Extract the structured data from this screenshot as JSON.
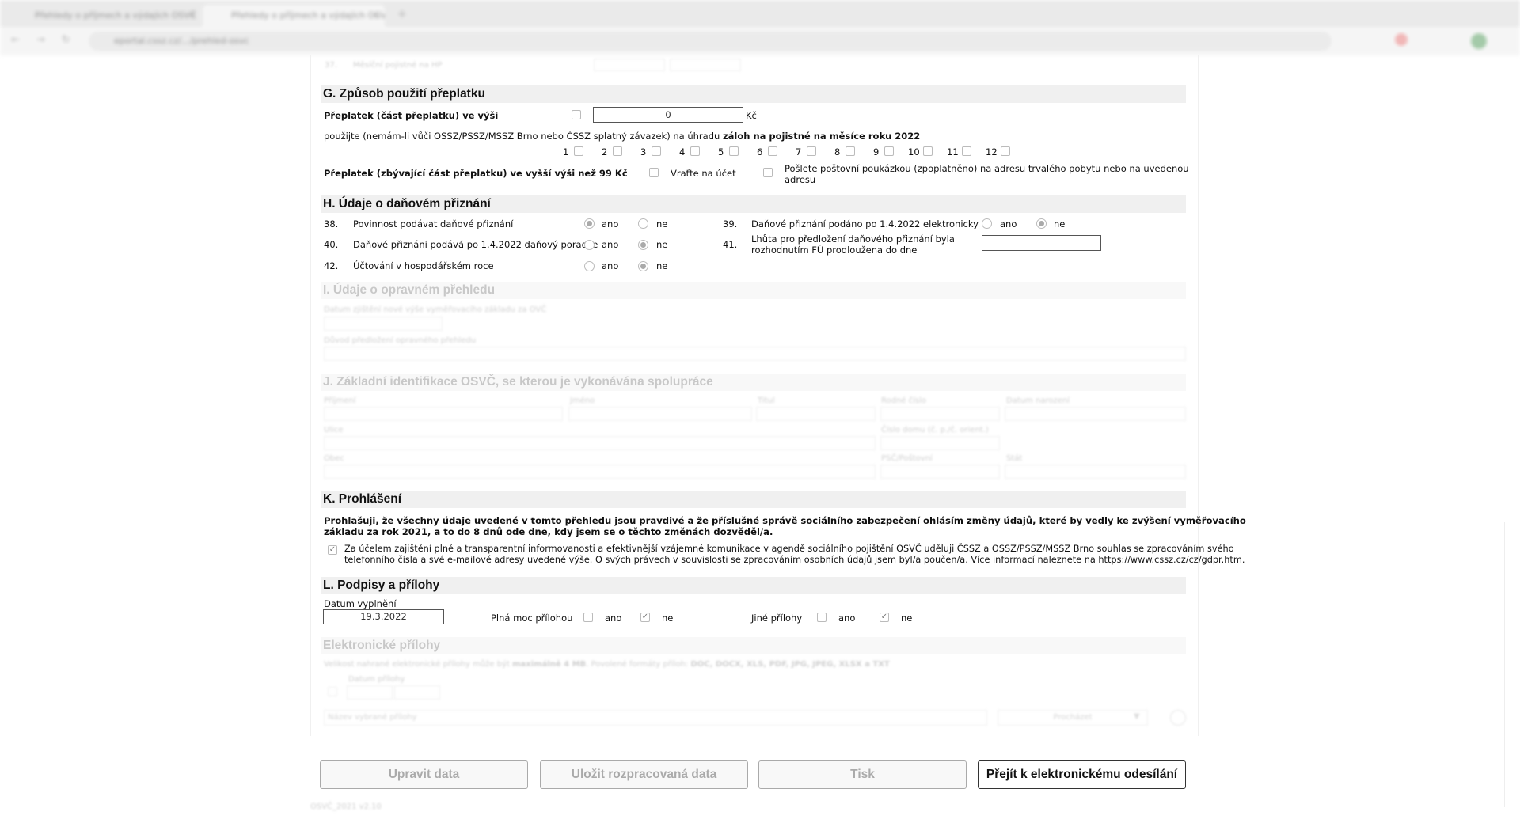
{
  "browser": {
    "tabs": [
      {
        "title": "Přehledy o příjmech a výdajích OSVČ"
      },
      {
        "title": "Přehledy o příjmech a výdajích OSVČ"
      }
    ],
    "url": "eportal.cssz.cz/…/prehled-osvc"
  },
  "section_g": {
    "title": "G. Způsob použití přeplatku",
    "overpay_label": "Přeplatek (část přeplatku) ve výši",
    "overpay_value": "0",
    "currency": "Kč",
    "use_text_plain": "použijte (nemám-li vůči OSSZ/PSSZ/MSSZ Brno nebo ČSSZ splatný závazek) na úhradu",
    "use_text_bold": "záloh na pojistné na měsíce roku 2022",
    "months": [
      "1",
      "2",
      "3",
      "4",
      "5",
      "6",
      "7",
      "8",
      "9",
      "10",
      "11",
      "12"
    ],
    "remaining_label": "Přeplatek (zbývající část přeplatku) ve vyšší výši než 99 Kč",
    "return_label": "Vraťte na účet",
    "postal_label_1": "Pošlete poštovní poukázkou (zpoplatněno) na adresu trvalého pobytu nebo na uvedenou",
    "postal_label_2": "adresu"
  },
  "section_h": {
    "title": "H. Údaje o daňovém přiznání",
    "yes": "ano",
    "no": "ne",
    "rows": [
      {
        "num": "38.",
        "label": "Povinnost podávat daňové přiznání",
        "value": "ano"
      },
      {
        "num": "40.",
        "label": "Daňové přiznání podává po 1.4.2022 daňový poradce",
        "value": "ne"
      },
      {
        "num": "42.",
        "label": "Účtování v hospodářském roce",
        "value": "ne"
      },
      {
        "num": "39.",
        "label": "Daňové přiznání podáno po 1.4.2022 elektronicky",
        "value": "ne"
      },
      {
        "num": "41.",
        "label_1": "Lhůta pro předložení daňového přiznání byla",
        "label_2": "rozhodnutím FÚ prodloužena do dne",
        "value": ""
      }
    ]
  },
  "section_i": {
    "title": "I. Údaje o opravném přehledu",
    "field1": "Datum zjištění nové výše vyměřovacího základu za OVČ",
    "field2": "Důvod předložení opravného přehledu"
  },
  "section_j": {
    "title": "J. Základní identifikace OSVČ, se kterou je vykonávána spolupráce",
    "fields": [
      "Příjmení",
      "Jméno",
      "Titul",
      "Rodné číslo",
      "Datum narození",
      "Ulice",
      "Číslo domu (č. p./č. orient.)",
      "Obec",
      "PSČ/Poštovní",
      "Stát"
    ]
  },
  "section_k": {
    "title": "K. Prohlášení",
    "declaration_1": "Prohlašuji, že všechny údaje uvedené v tomto přehledu jsou pravdivé a že příslušné správě sociálního zabezpečení ohlásím změny údajů, které by vedly ke zvýšení vyměřovacího",
    "declaration_2": "základu za rok 2021, a to do 8 dnů ode dne, kdy jsem se o těchto změnách dozvěděl/a.",
    "consent_1": "Za účelem zajištění plné a transparentní informovanosti a efektivnější vzájemné komunikace v agendě sociálního pojištění OSVČ uděluji ČSSZ a OSSZ/PSSZ/MSSZ Brno souhlas se zpracováním svého",
    "consent_2": "telefonního čísla a své e-mailové adresy uvedené výše. O svých právech v souvislosti se zpracováním osobních údajů jsem byl/a poučen/a. Více informací naleznete na https://www.cssz.cz/cz/gdpr.htm.",
    "consent_checked": true
  },
  "section_l": {
    "title": "L. Podpisy a přílohy",
    "date_label": "Datum vyplnění",
    "date_value": "19.3.2022",
    "power_label": "Plná moc přílohou",
    "other_label": "Jiné přílohy",
    "yes": "ano",
    "no": "ne",
    "power_value": "ne",
    "other_value": "ne"
  },
  "attachments": {
    "title": "Elektronické přílohy",
    "hint_a": "Velikost nahrané elektronické přílohy může být",
    "hint_b": "maximálně 4 MB",
    "hint_c": ". Povolené formáty příloh:",
    "hint_d": "DOC, DOCX, XLS, PDF, JPG, JPEG, XLSX a TXT",
    "date_label": "Datum přílohy",
    "name_placeholder": "Název vybrané přílohy",
    "select_label": "Procházet"
  },
  "buttons": {
    "edit": "Upravit data",
    "save": "Uložit rozpracovaná data",
    "print": "Tisk",
    "submit": "Přejít k elektronickému odesílání"
  },
  "footer": {
    "version": "OSVČ_2021 v2.10"
  }
}
